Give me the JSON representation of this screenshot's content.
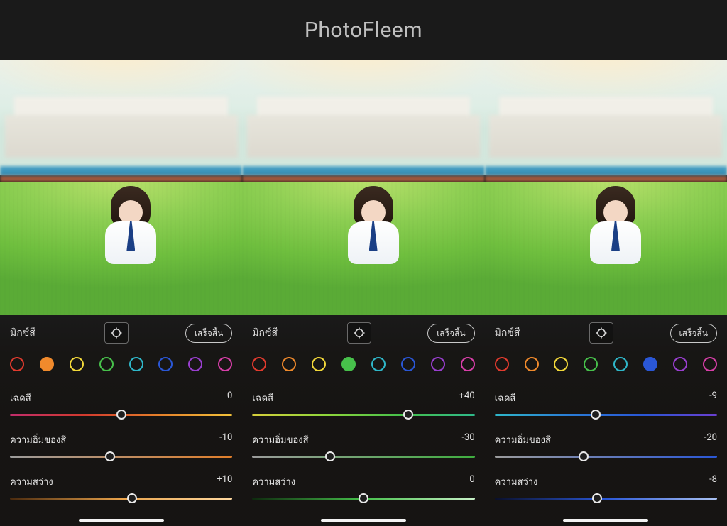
{
  "app": {
    "title": "PhotoFleem"
  },
  "labels": {
    "panel_title": "มิกซ์สี",
    "done": "เสร็จสิ้น",
    "hue": "เฉดสี",
    "saturation": "ความอิ่มของสี",
    "luminance": "ความสว่าง"
  },
  "swatch_colors": [
    "#e23b2e",
    "#f08a2c",
    "#f2d83a",
    "#47c04b",
    "#2fb7c9",
    "#2a57d6",
    "#9a3fd0",
    "#d83fa9"
  ],
  "panels": [
    {
      "selected_index": 1,
      "sliders": {
        "hue": {
          "value": 0,
          "min": -100,
          "max": 100,
          "display": "0",
          "gradient": [
            "#c12d6b",
            "#d23a2e",
            "#e57f2a",
            "#f2c23a"
          ]
        },
        "saturation": {
          "value": -10,
          "min": -100,
          "max": 100,
          "display": "-10",
          "gradient": [
            "#9c9c9c",
            "#e07e2a"
          ]
        },
        "luminance": {
          "value": 10,
          "min": -100,
          "max": 100,
          "display": "+10",
          "gradient": [
            "#4a2a0e",
            "#e8a24a",
            "#ffd9a0"
          ]
        }
      }
    },
    {
      "selected_index": 3,
      "sliders": {
        "hue": {
          "value": 40,
          "min": -100,
          "max": 100,
          "display": "+40",
          "gradient": [
            "#d6cf3b",
            "#8fd63b",
            "#46c04b",
            "#2fb98a"
          ]
        },
        "saturation": {
          "value": -30,
          "min": -100,
          "max": 100,
          "display": "-30",
          "gradient": [
            "#9c9c9c",
            "#3fae3f"
          ]
        },
        "luminance": {
          "value": 0,
          "min": -100,
          "max": 100,
          "display": "0",
          "gradient": [
            "#0e2a0e",
            "#46c04b",
            "#c9f2c9"
          ]
        }
      }
    },
    {
      "selected_index": 5,
      "sliders": {
        "hue": {
          "value": -9,
          "min": -100,
          "max": 100,
          "display": "-9",
          "gradient": [
            "#2fb7c9",
            "#2a7cd6",
            "#2a57d6",
            "#6a3fd0"
          ]
        },
        "saturation": {
          "value": -20,
          "min": -100,
          "max": 100,
          "display": "-20",
          "gradient": [
            "#9c9c9c",
            "#2a57d6"
          ]
        },
        "luminance": {
          "value": -8,
          "min": -100,
          "max": 100,
          "display": "-8",
          "gradient": [
            "#0a0f2a",
            "#2a57d6",
            "#aac2f2"
          ]
        }
      }
    }
  ]
}
